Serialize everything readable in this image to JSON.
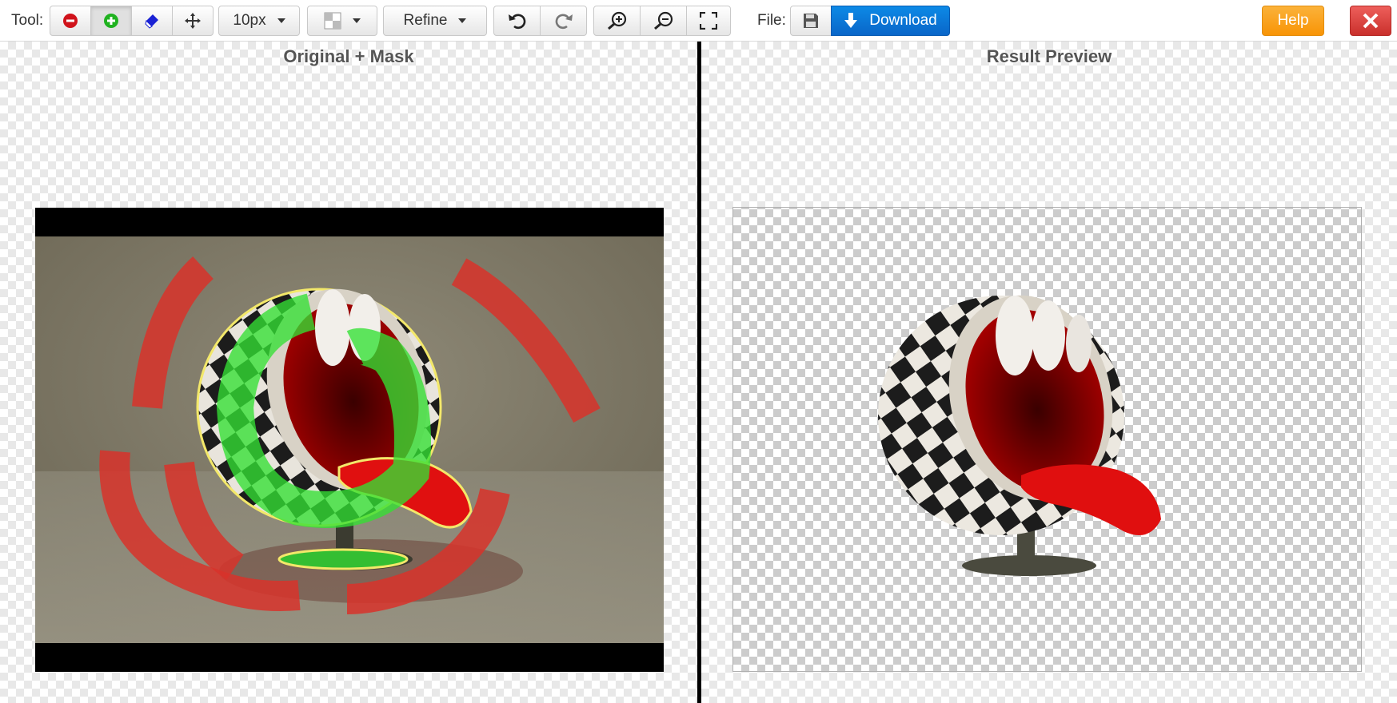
{
  "toolbar": {
    "tool_label": "Tool:",
    "tools": [
      {
        "name": "remove-tool",
        "icon": "minus-circle-icon",
        "color": "#d0131b",
        "active": false
      },
      {
        "name": "add-tool",
        "icon": "plus-circle-icon",
        "color": "#1fb21f",
        "active": true
      },
      {
        "name": "eraser-tool",
        "icon": "eraser-icon",
        "color": "#1a22d4",
        "active": false
      },
      {
        "name": "move-tool",
        "icon": "move-arrows-icon",
        "color": "#333333",
        "active": false
      }
    ],
    "brush_size": "10px",
    "view_mode_icon": "view-mode-icon",
    "refine_label": "Refine",
    "undo_icon": "undo-icon",
    "redo_icon": "redo-icon",
    "zoom_in_icon": "zoom-in-icon",
    "zoom_out_icon": "zoom-out-icon",
    "fit_icon": "fit-screen-icon",
    "file_label": "File:",
    "save_icon": "save-icon",
    "download_label": "Download",
    "help_label": "Help",
    "close_icon": "close-icon"
  },
  "panels": {
    "left_title": "Original + Mask",
    "right_title": "Result Preview"
  },
  "colors": {
    "primary": "#0a6fd6",
    "warning": "#f89406",
    "danger": "#d9463f",
    "mask_remove": "#d8322a",
    "mask_keep": "#33e033"
  }
}
